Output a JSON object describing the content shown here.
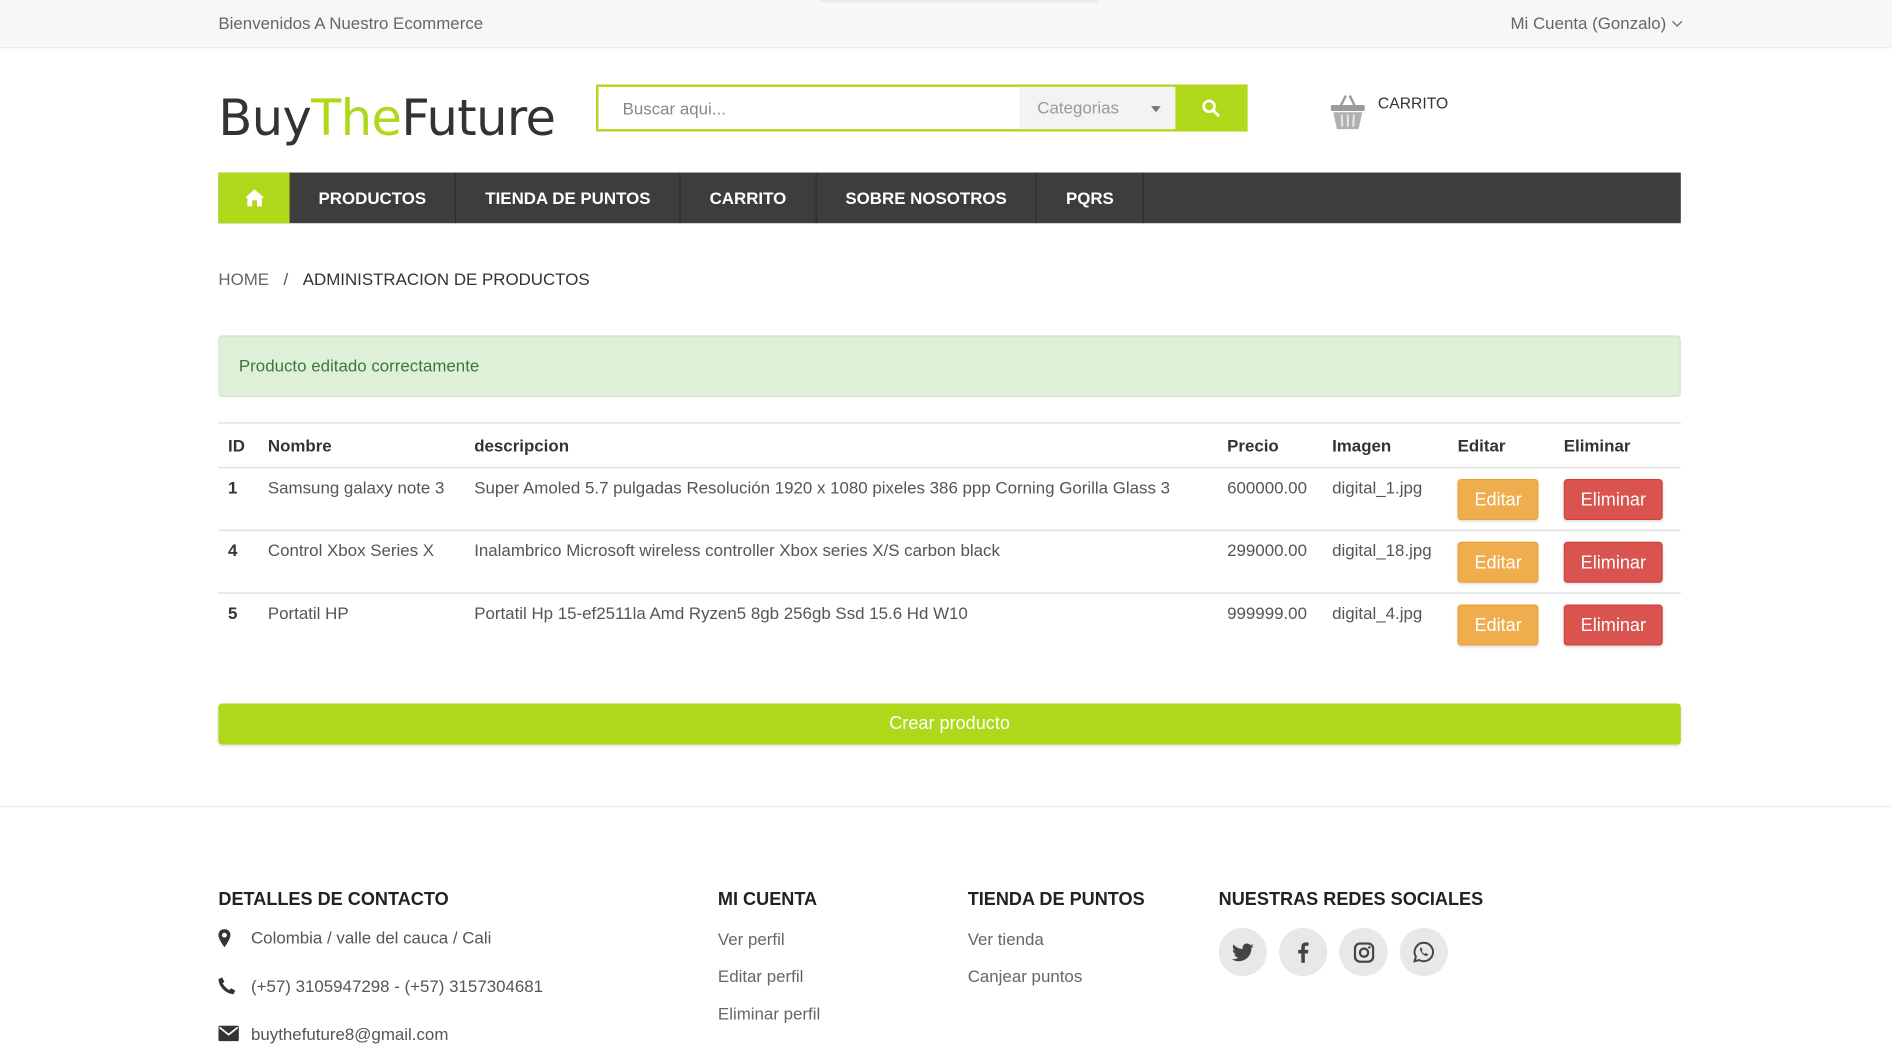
{
  "topbar": {
    "welcome": "Bienvenidos A Nuestro Ecommerce",
    "account": "Mi Cuenta (Gonzalo)"
  },
  "header": {
    "logo_part1": "Buy",
    "logo_part2": "The",
    "logo_part3": "Future",
    "search_placeholder": "Buscar aqui...",
    "categories_label": "Categorias",
    "cart_label": "CARRITO"
  },
  "nav": {
    "items": [
      "PRODUCTOS",
      "TIENDA DE PUNTOS",
      "CARRITO",
      "SOBRE NOSOTROS",
      "PQRS"
    ]
  },
  "breadcrumb": {
    "home": "HOME",
    "separator": "/",
    "current": "ADMINISTRACION DE PRODUCTOS"
  },
  "alert": {
    "message": "Producto editado correctamente"
  },
  "table": {
    "headers": [
      "ID",
      "Nombre",
      "descripcion",
      "Precio",
      "Imagen",
      "Editar",
      "Eliminar"
    ],
    "rows": [
      {
        "id": "1",
        "nombre": "Samsung galaxy note 3",
        "descripcion": "Super Amoled 5.7 pulgadas Resolución 1920 x 1080 pixeles 386 ppp Corning Gorilla Glass 3",
        "precio": "600000.00",
        "imagen": "digital_1.jpg",
        "editar": "Editar",
        "eliminar": "Eliminar"
      },
      {
        "id": "4",
        "nombre": "Control Xbox Series X",
        "descripcion": "Inalambrico Microsoft wireless controller Xbox series X/S carbon black",
        "precio": "299000.00",
        "imagen": "digital_18.jpg",
        "editar": "Editar",
        "eliminar": "Eliminar"
      },
      {
        "id": "5",
        "nombre": "Portatil HP",
        "descripcion": "Portatil Hp 15-ef2511la Amd Ryzen5 8gb 256gb Ssd 15.6 Hd W10",
        "precio": "999999.00",
        "imagen": "digital_4.jpg",
        "editar": "Editar",
        "eliminar": "Eliminar"
      }
    ]
  },
  "create_button": "Crear producto",
  "footer": {
    "contact_title": "DETALLES DE CONTACTO",
    "address": "Colombia / valle del cauca / Cali",
    "phone": "(+57) 3105947298 - (+57) 3157304681",
    "email": "buythefuture8@gmail.com",
    "account_title": "MI CUENTA",
    "account_links": [
      "Ver perfil",
      "Editar perfil",
      "Eliminar perfil"
    ],
    "store_title": "TIENDA DE PUNTOS",
    "store_links": [
      "Ver tienda",
      "Canjear puntos"
    ],
    "social_title": "NUESTRAS REDES SOCIALES",
    "social_icons": [
      "twitter-icon",
      "facebook-icon",
      "instagram-icon",
      "whatsapp-icon"
    ]
  },
  "colors": {
    "accent": "#afd81a",
    "nav_bg": "#3d3d3d",
    "edit": "#f0ad4e",
    "delete": "#d9534f",
    "alert_bg": "#dff0d8"
  }
}
